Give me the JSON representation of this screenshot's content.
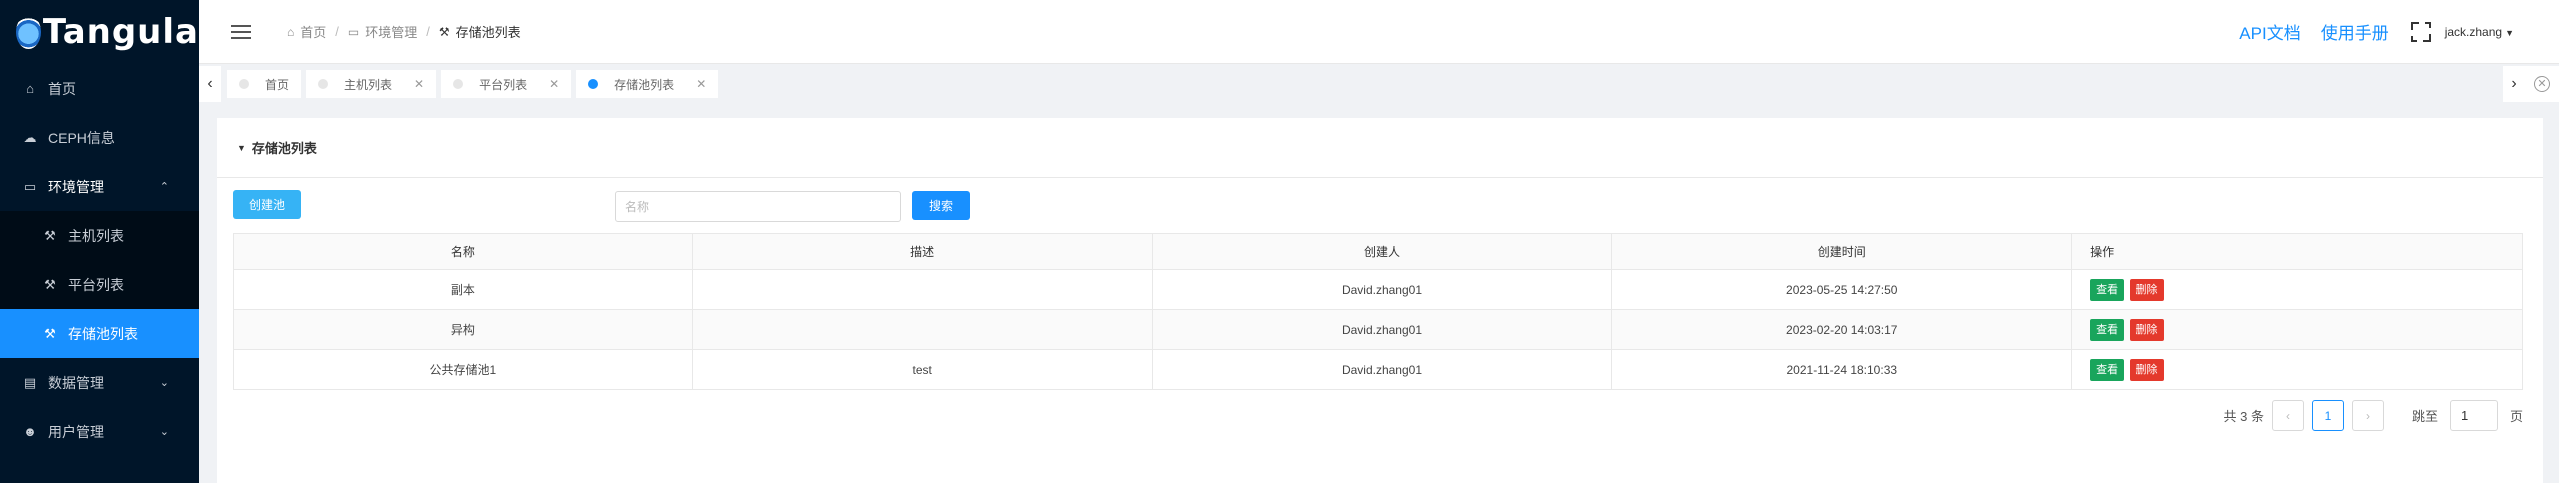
{
  "app": {
    "logo_text": "Tangula"
  },
  "sidebar": {
    "items": [
      {
        "label": "首页",
        "icon": "home-icon"
      },
      {
        "label": "CEPH信息",
        "icon": "cloud-icon"
      },
      {
        "label": "环境管理",
        "icon": "monitor-icon",
        "expanded": true,
        "children": [
          {
            "label": "主机列表",
            "icon": "hammer-icon"
          },
          {
            "label": "平台列表",
            "icon": "hammer-icon"
          },
          {
            "label": "存储池列表",
            "icon": "hammer-icon",
            "active": true
          }
        ]
      },
      {
        "label": "数据管理",
        "icon": "database-icon"
      },
      {
        "label": "用户管理",
        "icon": "user-icon"
      }
    ]
  },
  "header": {
    "breadcrumb": [
      "首页",
      "环境管理",
      "存储池列表"
    ],
    "api_docs": "API文档",
    "manual": "使用手册",
    "username": "jack.zhang"
  },
  "tabs": [
    {
      "label": "首页",
      "closable": false,
      "active": false
    },
    {
      "label": "主机列表",
      "closable": true,
      "active": false
    },
    {
      "label": "平台列表",
      "closable": true,
      "active": false
    },
    {
      "label": "存储池列表",
      "closable": true,
      "active": true
    }
  ],
  "card": {
    "title": "存储池列表",
    "create_label": "创建池",
    "search_placeholder": "名称",
    "search_label": "搜索"
  },
  "table": {
    "columns": [
      "名称",
      "描述",
      "创建人",
      "创建时间",
      "操作"
    ],
    "rows": [
      {
        "name": "副本",
        "desc": "",
        "creator": "David.zhang01",
        "created": "2023-05-25 14:27:50"
      },
      {
        "name": "异构",
        "desc": "",
        "creator": "David.zhang01",
        "created": "2023-02-20 14:03:17"
      },
      {
        "name": "公共存储池1",
        "desc": "test",
        "creator": "David.zhang01",
        "created": "2021-11-24 18:10:33"
      }
    ],
    "view_label": "查看",
    "delete_label": "删除"
  },
  "pagination": {
    "total_text": "共 3 条",
    "current_page": "1",
    "jump_label": "跳至",
    "jump_value": "1",
    "page_suffix": "页"
  },
  "colors": {
    "primary": "#1890ff",
    "sidebar_bg": "#001529",
    "view": "#19a55c",
    "delete": "#e4392c",
    "create": "#36b3f5"
  }
}
